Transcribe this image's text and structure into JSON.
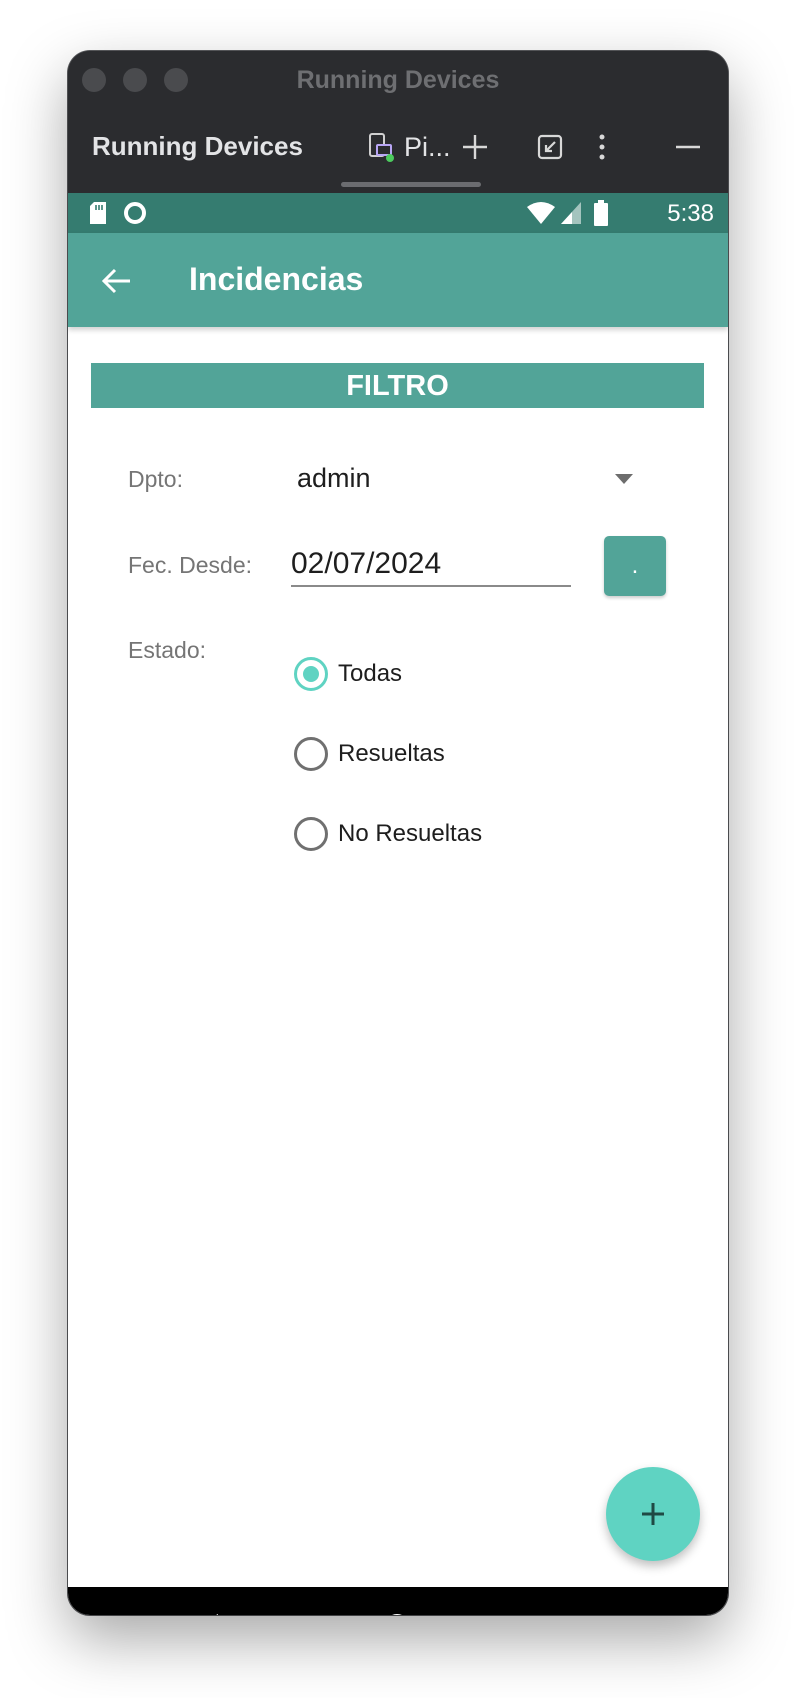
{
  "window": {
    "title": "Running Devices"
  },
  "toolbar": {
    "title": "Running Devices",
    "tab_label": "Pi..."
  },
  "statusbar": {
    "time": "5:38"
  },
  "app": {
    "title": "Incidencias",
    "accent_color": "#52a498",
    "radio_color": "#5fd3c2"
  },
  "filter": {
    "header": "FILTRO",
    "dpto_label": "Dpto:",
    "dpto_value": "admin",
    "date_label": "Fec. Desde:",
    "date_value": "02/07/2024",
    "date_button_label": ".",
    "estado_label": "Estado:",
    "options": [
      {
        "label": "Todas",
        "checked": true
      },
      {
        "label": "Resueltas",
        "checked": false
      },
      {
        "label": "No Resueltas",
        "checked": false
      }
    ]
  },
  "fab": {
    "icon": "plus-icon"
  },
  "navbar": {
    "icons": [
      "back-triangle-icon",
      "home-circle-icon",
      "recents-square-icon"
    ]
  }
}
